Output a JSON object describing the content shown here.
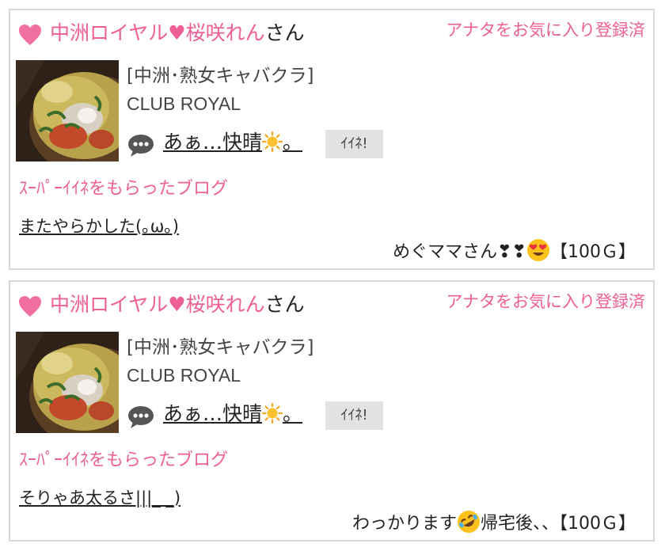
{
  "posts": [
    {
      "shop_member": "中洲ロイヤル♥桜咲れん",
      "san": "さん",
      "fav_status": "アナタをお気に入り登録済",
      "shop_type": "[中洲･熟女キャバクラ]",
      "shop_name": "CLUB ROYAL",
      "post_title": "あぁ…快晴",
      "post_title_suffix": "。",
      "like_button": "ｲｲﾈ!",
      "super_label": "ｽｰﾊﾟｰｲｲﾈをもらったブログ",
      "blog_title": "またやらかした(｡ω｡)",
      "giver": "めぐママさん❣❣",
      "giver_emoji": "heart-eyes-emoji",
      "amount": "【100Ｇ】"
    },
    {
      "shop_member": "中洲ロイヤル♥桜咲れん",
      "san": "さん",
      "fav_status": "アナタをお気に入り登録済",
      "shop_type": "[中洲･熟女キャバクラ]",
      "shop_name": "CLUB ROYAL",
      "post_title": "あぁ…快晴",
      "post_title_suffix": "。",
      "like_button": "ｲｲﾈ!",
      "super_label": "ｽｰﾊﾟｰｲｲﾈをもらったブログ",
      "blog_title": "そりゃあ太るさ|||_ _)",
      "giver": "わっかります",
      "giver_emoji": "rolling-laughing-emoji",
      "giver_after": "帰宅後、、",
      "amount": "【100Ｇ】"
    }
  ],
  "colors": {
    "accent": "#ee5f95",
    "heart": "#f26fa2",
    "button_bg": "#e2e2e2",
    "border": "#d8d8d8"
  }
}
